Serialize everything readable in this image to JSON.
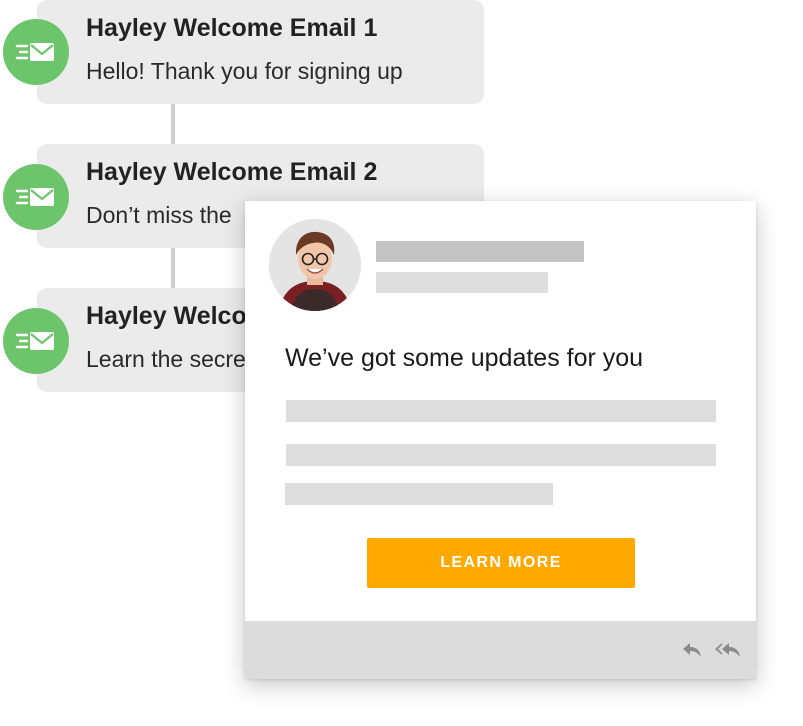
{
  "sequence": {
    "emails": [
      {
        "title": "Hayley Welcome Email 1",
        "subtitle": "Hello! Thank you for signing up"
      },
      {
        "title": "Hayley Welcome Email 2",
        "subtitle": "Don’t miss the"
      },
      {
        "title": "Hayley Welco",
        "subtitle": "Learn the secre"
      }
    ],
    "icon": "email-send-icon",
    "icon_color": "#6dc56b"
  },
  "preview": {
    "headline": "We’ve got some updates for you",
    "cta_label": "LEARN MORE",
    "cta_color": "#ffa800",
    "footer_icons": [
      "reply-icon",
      "reply-all-icon"
    ]
  }
}
